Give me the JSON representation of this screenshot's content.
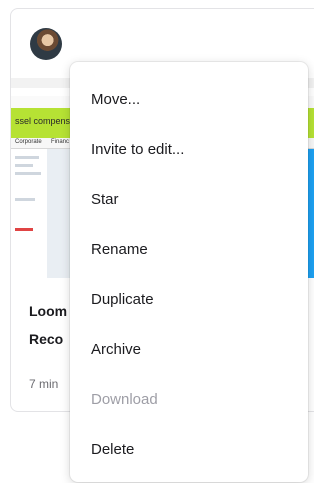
{
  "card": {
    "thumbnail": {
      "banner_text": "ssel compensation cap",
      "tab_left": "Corporate",
      "tab_right": "Financ"
    },
    "title_line_1": "Loom",
    "title_line_2": "Reco",
    "meta": "7 min"
  },
  "menu": {
    "items": [
      {
        "label": "Move...",
        "disabled": false
      },
      {
        "label": "Invite to edit...",
        "disabled": false
      },
      {
        "label": "Star",
        "disabled": false
      },
      {
        "label": "Rename",
        "disabled": false
      },
      {
        "label": "Duplicate",
        "disabled": false
      },
      {
        "label": "Archive",
        "disabled": false
      },
      {
        "label": "Download",
        "disabled": true
      },
      {
        "label": "Delete",
        "disabled": false
      }
    ]
  }
}
